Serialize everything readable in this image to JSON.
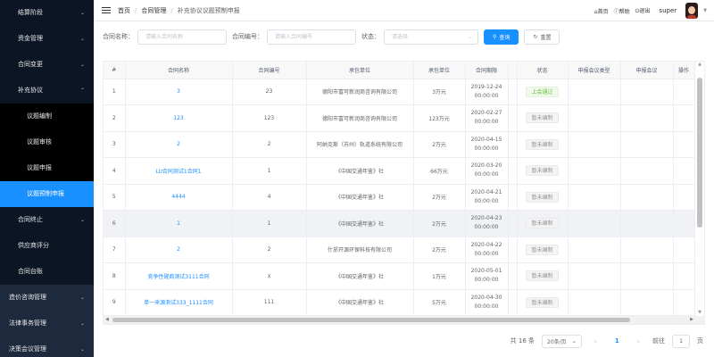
{
  "sidebar": {
    "items": [
      {
        "label": "结算阶段",
        "type": "group"
      },
      {
        "label": "资金管理",
        "type": "group"
      },
      {
        "label": "合同变更",
        "type": "group"
      },
      {
        "label": "补充协议",
        "type": "group-open"
      },
      {
        "label": "议题编制",
        "type": "sub"
      },
      {
        "label": "议题审核",
        "type": "sub"
      },
      {
        "label": "议题申报",
        "type": "sub"
      },
      {
        "label": "议题预制申报",
        "type": "sub-active"
      },
      {
        "label": "合同终止",
        "type": "group"
      },
      {
        "label": "供应商评分",
        "type": "plain"
      },
      {
        "label": "合同台账",
        "type": "plain"
      },
      {
        "label": "造价咨询管理",
        "type": "top"
      },
      {
        "label": "法律事务管理",
        "type": "top"
      },
      {
        "label": "决策会议管理",
        "type": "top"
      }
    ]
  },
  "header": {
    "breadcrumb": [
      "首页",
      "合同管理",
      "补充协议议题预制申报"
    ],
    "links": [
      "首页",
      "帮助",
      "退出"
    ],
    "user": "super"
  },
  "filters": {
    "contract_name_label": "合同名称：",
    "contract_name_placeholder": "请输入合同名称",
    "contract_no_label": "合同编号：",
    "contract_no_placeholder": "请输入合同编号",
    "status_label": "状态：",
    "status_placeholder": "请选择",
    "search_label": "查询",
    "reset_label": "重置"
  },
  "table": {
    "columns": [
      "#",
      "合同名称",
      "合同编号",
      "承包单位",
      "承包单位",
      "合同期限",
      "",
      "状态",
      "申报会议类型",
      "申报会议",
      "操作"
    ],
    "rows": [
      {
        "idx": "1",
        "name": "3",
        "no": "23",
        "company": "德阳市富可新润商咨询有限公司",
        "amount": "3万元",
        "date": "2019-12-24 00:00:00",
        "status": "上会通过",
        "ok": true
      },
      {
        "idx": "2",
        "name": "123",
        "no": "123",
        "company": "德阳市富可新润商咨询有限公司",
        "amount": "123万元",
        "date": "2020-02-27 00:00:00",
        "status": "暂未编制",
        "ok": false
      },
      {
        "idx": "3",
        "name": "2",
        "no": "2",
        "company": "阿纳克斯（苏州）轨道系统有限公司",
        "amount": "2万元",
        "date": "2020-04-15 00:00:00",
        "status": "暂未编制",
        "ok": false
      },
      {
        "idx": "4",
        "name": "LU合同测试1合同1",
        "no": "1",
        "company": "《中国交通年鉴》社",
        "amount": "66万元",
        "date": "2020-03-20 00:00:00",
        "status": "暂未编制",
        "ok": false
      },
      {
        "idx": "5",
        "name": "4444",
        "no": "4",
        "company": "《中国交通年鉴》社",
        "amount": "2万元",
        "date": "2020-04-21 00:00:00",
        "status": "暂未编制",
        "ok": false
      },
      {
        "idx": "6",
        "name": "1",
        "no": "1",
        "company": "《中国交通年鉴》社",
        "amount": "2万元",
        "date": "2020-04-23 00:00:00",
        "status": "暂未编制",
        "ok": false
      },
      {
        "idx": "7",
        "name": "2",
        "no": "2",
        "company": "什邡开源环保科技有限公司",
        "amount": "2万元",
        "date": "2020-04-22 00:00:00",
        "status": "暂未编制",
        "ok": false
      },
      {
        "idx": "8",
        "name": "竞争性磋商测试3111合同",
        "no": "x",
        "company": "《中国交通年鉴》社",
        "amount": "1万元",
        "date": "2020-05-01 00:00:00",
        "status": "暂未编制",
        "ok": false
      },
      {
        "idx": "9",
        "name": "单一来源测试333_1111合同",
        "no": "111",
        "company": "《中国交通年鉴》社",
        "amount": "5万元",
        "date": "2020-04-30 00:00:00",
        "status": "暂未编制",
        "ok": false
      }
    ]
  },
  "pager": {
    "total": "共 16 条",
    "size": "20条/页",
    "current": "1",
    "goto_label": "前往",
    "goto_value": "1",
    "page_suffix": "页"
  },
  "colors": {
    "sidebar_bg": "#0c1524",
    "accent": "#1890ff",
    "success": "#67c23a"
  }
}
